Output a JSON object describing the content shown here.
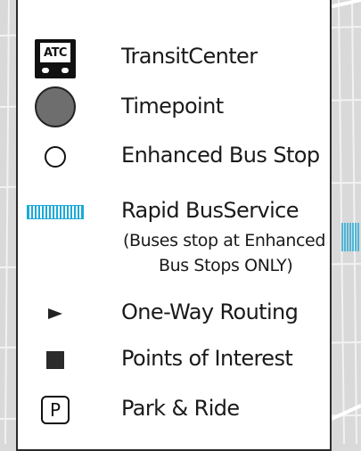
{
  "legend": {
    "items": [
      {
        "label": "TransitCenter",
        "icon": "atc-transit-center-icon",
        "icon_text": "ATC"
      },
      {
        "label": "Timepoint",
        "icon": "timepoint-circle-icon"
      },
      {
        "label": "Enhanced Bus Stop",
        "icon": "enhanced-stop-circle-icon"
      },
      {
        "label": "Rapid BusService",
        "icon": "rapid-bus-hatch-icon"
      },
      {
        "label": "One-Way Routing",
        "icon": "triangle-right-icon"
      },
      {
        "label": "Points of Interest",
        "icon": "square-icon"
      },
      {
        "label": "Park & Ride",
        "icon": "park-and-ride-icon",
        "icon_text": "P"
      }
    ],
    "rapid_note_line1": "(Buses stop at Enhanced",
    "rapid_note_line2": "Bus Stops ONLY)"
  },
  "colors": {
    "rapid_blue": "#1ca9d8",
    "timepoint_gray": "#6e6e6e",
    "map_background": "#d9d9d9"
  }
}
